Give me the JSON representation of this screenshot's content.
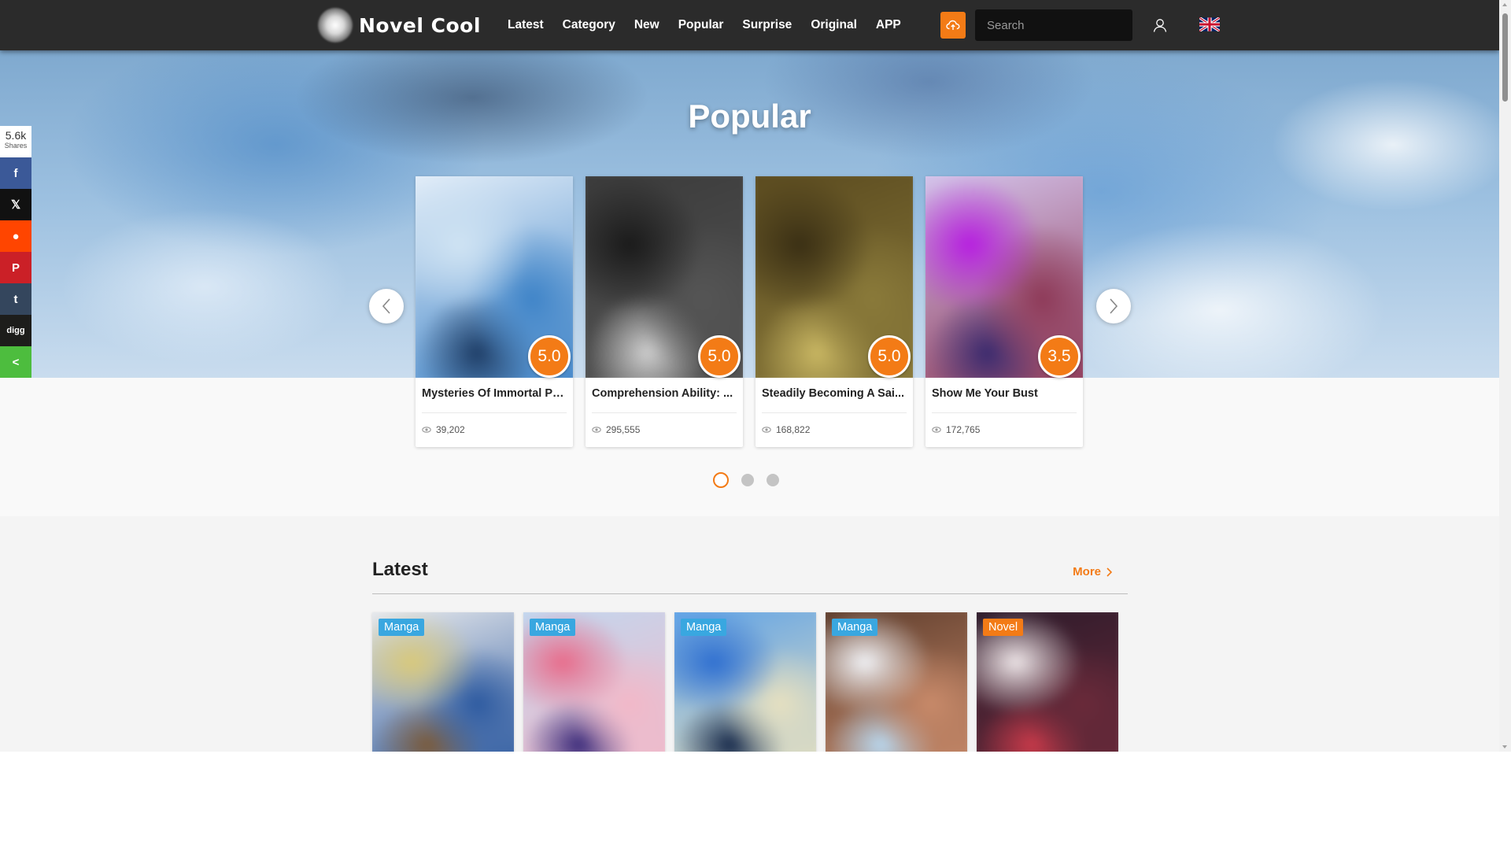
{
  "header": {
    "logo_text": "Novel Cool",
    "nav": [
      "Latest",
      "Category",
      "New",
      "Popular",
      "Surprise",
      "Original",
      "APP"
    ],
    "search_placeholder": "Search",
    "icons": {
      "upload": "cloud-upload-icon",
      "user": "user-icon",
      "language": "uk-flag-icon"
    },
    "accent_color": "#f37b16"
  },
  "share_bar": {
    "count": "5.6k",
    "count_label": "Shares",
    "buttons": [
      {
        "name": "facebook",
        "glyph": "f",
        "color": "#3b5998"
      },
      {
        "name": "x",
        "glyph": "𝕏",
        "color": "#111111"
      },
      {
        "name": "reddit",
        "glyph": "●",
        "color": "#ff4500"
      },
      {
        "name": "pinterest",
        "glyph": "P",
        "color": "#cb2027"
      },
      {
        "name": "tumblr",
        "glyph": "t",
        "color": "#34465d"
      },
      {
        "name": "digg",
        "glyph": "digg",
        "color": "#1d1d1b"
      },
      {
        "name": "share",
        "glyph": "<",
        "color": "#4dbd3e"
      }
    ]
  },
  "popular": {
    "title": "Popular",
    "cards": [
      {
        "title": "Mysteries Of Immortal Pu...",
        "rating": "5.0",
        "views": "39,202",
        "palette": [
          "#cfe3f3",
          "#3f84c8",
          "#1e3d66",
          "#e8f1fa"
        ]
      },
      {
        "title": "Comprehension Ability: ...",
        "rating": "5.0",
        "views": "295,555",
        "palette": [
          "#1a1a1a",
          "#555555",
          "#cfcfcf",
          "#3a3a3a"
        ]
      },
      {
        "title": "Steadily Becoming A Sai...",
        "rating": "5.0",
        "views": "168,822",
        "palette": [
          "#3a2f14",
          "#8a7a3a",
          "#c9b763",
          "#5a4a1f"
        ]
      },
      {
        "title": "Show Me Your Bust",
        "rating": "3.5",
        "views": "172,765",
        "palette": [
          "#b61ee0",
          "#8e3a58",
          "#3a2a6e",
          "#d6c8f0"
        ]
      }
    ],
    "page_dots": 3,
    "active_dot": 0
  },
  "latest": {
    "title": "Latest",
    "more_label": "More",
    "cards": [
      {
        "tag": "Manga",
        "tag_color": "#39a7e0",
        "palette": [
          "#d9c97a",
          "#2d5aa0",
          "#7a5a3a",
          "#f0f0f0"
        ]
      },
      {
        "tag": "Manga",
        "tag_color": "#39a7e0",
        "palette": [
          "#e86b8a",
          "#f2b8c8",
          "#3a2a7a",
          "#c0d8f0"
        ]
      },
      {
        "tag": "Manga",
        "tag_color": "#39a7e0",
        "palette": [
          "#2f6fd0",
          "#e6e0c0",
          "#15284a",
          "#5aa0e8"
        ]
      },
      {
        "tag": "Manga",
        "tag_color": "#39a7e0",
        "palette": [
          "#f2f4f8",
          "#c88a6a",
          "#b8d8f0",
          "#5a3a2a"
        ]
      },
      {
        "tag": "Novel",
        "tag_color": "#f37b16",
        "palette": [
          "#f0e8ea",
          "#6a2a3a",
          "#c83a4a",
          "#2a1a2a"
        ]
      }
    ]
  }
}
